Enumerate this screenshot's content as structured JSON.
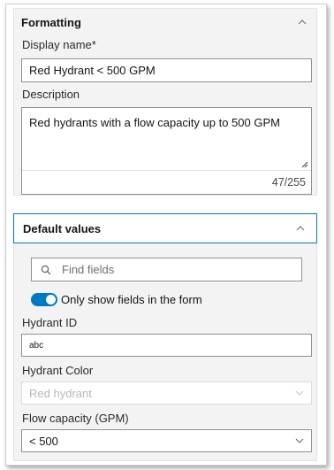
{
  "formatting": {
    "title": "Formatting",
    "display_name_label": "Display name*",
    "display_name_value": "Red Hydrant < 500 GPM",
    "description_label": "Description",
    "description_value": "Red hydrants with a flow capacity up to 500 GPM",
    "char_count": "47/255"
  },
  "default_values": {
    "title": "Default values",
    "search_placeholder": "Find fields",
    "toggle_label": "Only show fields in the form",
    "toggle_on": true,
    "fields": {
      "hydrant_id_label": "Hydrant ID",
      "hydrant_id_value": "abc",
      "hydrant_color_label": "Hydrant Color",
      "hydrant_color_value": "Red hydrant",
      "flow_capacity_label": "Flow capacity (GPM)",
      "flow_capacity_value": "< 500"
    }
  },
  "colors": {
    "accent": "#007ac2",
    "border": "#8f8f8f",
    "disabled_text": "#b8b8b8"
  }
}
